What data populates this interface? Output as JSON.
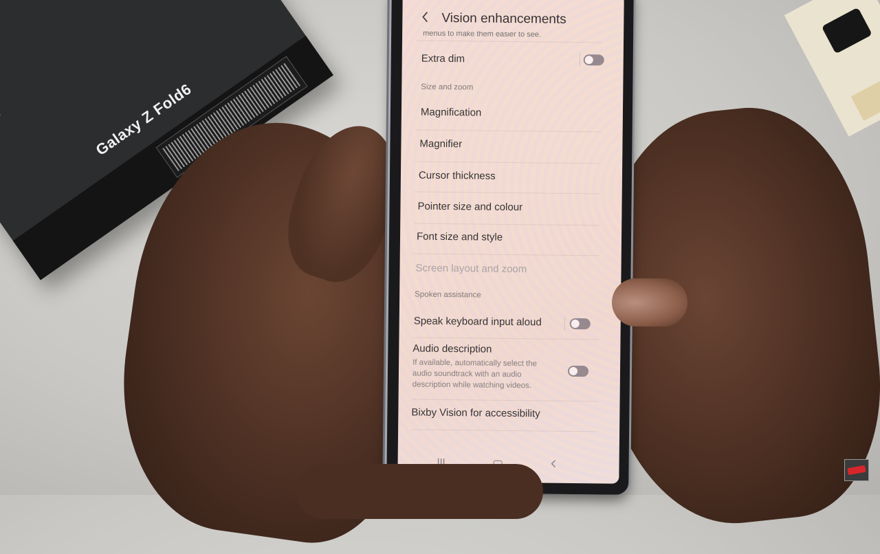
{
  "scene": {
    "box_title": "Galaxy Z Fold6"
  },
  "screen": {
    "header": {
      "back_icon": "chevron-left-icon",
      "title": "Vision enhancements"
    },
    "cut_description": "menus to make them easier to see.",
    "items": [
      {
        "label": "Extra dim",
        "toggle": false
      },
      {
        "section": "Size and zoom"
      },
      {
        "label": "Magnification"
      },
      {
        "label": "Magnifier"
      },
      {
        "label": "Cursor thickness"
      },
      {
        "label": "Pointer size and colour"
      },
      {
        "label": "Font size and style"
      },
      {
        "label": "Screen layout and zoom",
        "disabled": true
      },
      {
        "section": "Spoken assistance"
      },
      {
        "label": "Speak keyboard input aloud",
        "toggle": false
      },
      {
        "label": "Audio description",
        "description": "If available, automatically select the audio soundtrack with an audio description while watching videos.",
        "toggle": false
      },
      {
        "label": "Bixby Vision for accessibility"
      }
    ],
    "navbar": {
      "recents_icon": "III",
      "home_icon": "home-icon",
      "back_icon": "‹"
    }
  },
  "colors": {
    "screen_bg": "#f3dcd6",
    "toggle_off": "#8d8188",
    "text_primary": "#222222",
    "text_disabled": "#a49e9e"
  }
}
